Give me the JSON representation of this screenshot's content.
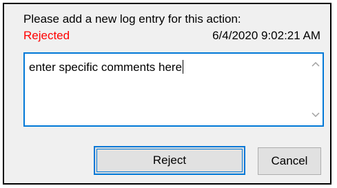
{
  "dialog": {
    "prompt": "Please add a new log entry for this action:",
    "status": "Rejected",
    "timestamp": "6/4/2020 9:02:21 AM",
    "status_color": "#ff0000",
    "accent_color": "#0078d7"
  },
  "comment_box": {
    "value": "enter specific comments here"
  },
  "scrollbar": {
    "up_icon": "chevron-up-icon",
    "down_icon": "chevron-down-icon"
  },
  "buttons": {
    "reject_label": "Reject",
    "cancel_label": "Cancel"
  }
}
